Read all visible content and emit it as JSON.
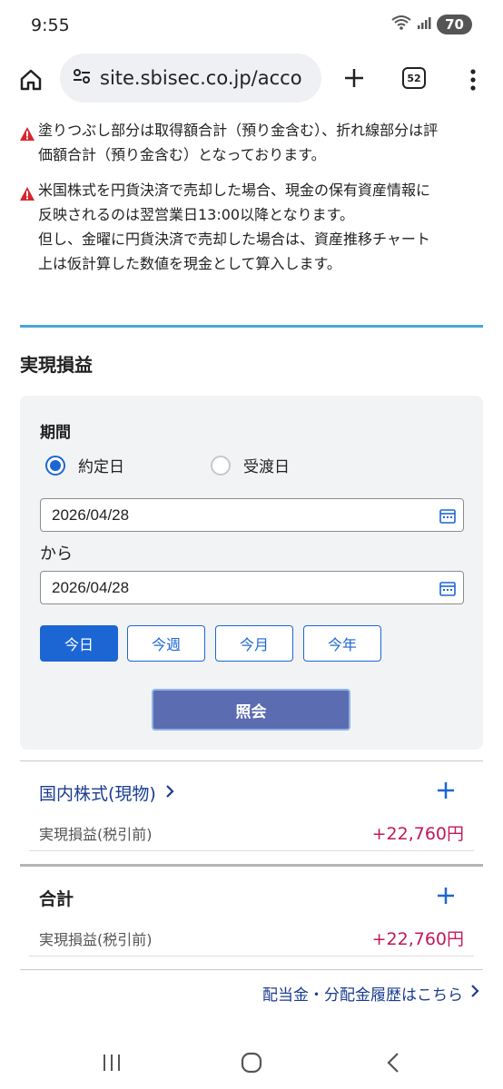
{
  "status_bar": {
    "time": "9:55",
    "battery": "70",
    "icons": [
      "wifi-icon",
      "signal-icon"
    ]
  },
  "browser": {
    "url": "site.sbisec.co.jp/acco",
    "tab_count": "52",
    "icons": [
      "home-icon",
      "site-settings-icon",
      "new-tab-icon",
      "more-icon"
    ]
  },
  "notices": [
    {
      "icon": "warning-icon",
      "lines": [
        "塗りつぶし部分は取得額合計（預り金含む）、折れ線部分は評",
        "価額合計（預り金含む）となっております。"
      ]
    },
    {
      "icon": "warning-icon",
      "lines": [
        "米国株式を円貨決済で売却した場合、現金の保有資産情報に",
        "反映されるのは翌営業日13:00以降となります。",
        "但し、金曜に円貨決済で売却した場合は、資産推移チャート",
        "上は仮計算した数値を現金として算入します。"
      ]
    }
  ],
  "section": {
    "title": "実現損益"
  },
  "filter": {
    "period_label": "期間",
    "radio_options": [
      {
        "label": "約定日",
        "selected": true
      },
      {
        "label": "受渡日",
        "selected": false
      }
    ],
    "date_from": "2026/04/28",
    "from_label": "から",
    "date_to": "2026/04/28",
    "quick_ranges": [
      {
        "label": "今日",
        "active": true
      },
      {
        "label": "今週",
        "active": false
      },
      {
        "label": "今月",
        "active": false
      },
      {
        "label": "今年",
        "active": false
      }
    ],
    "query_button": "照会"
  },
  "results": {
    "domestic": {
      "title": "国内株式(現物)",
      "row_label": "実現損益(税引前)",
      "row_value": "+22,760円"
    },
    "total": {
      "title": "合計",
      "row_label": "実現損益(税引前)",
      "row_value": "+22,760円"
    }
  },
  "dividend_link": "配当金・分配金履歴はこちら",
  "colors": {
    "accent_blue": "#1c66d4",
    "query_button": "#5b6cb0",
    "profit": "#c2185b",
    "divider": "#4aa6d8",
    "link": "#1a3d8f"
  },
  "nav_icons": [
    "recent-apps-icon",
    "home-circle-icon",
    "back-icon"
  ]
}
